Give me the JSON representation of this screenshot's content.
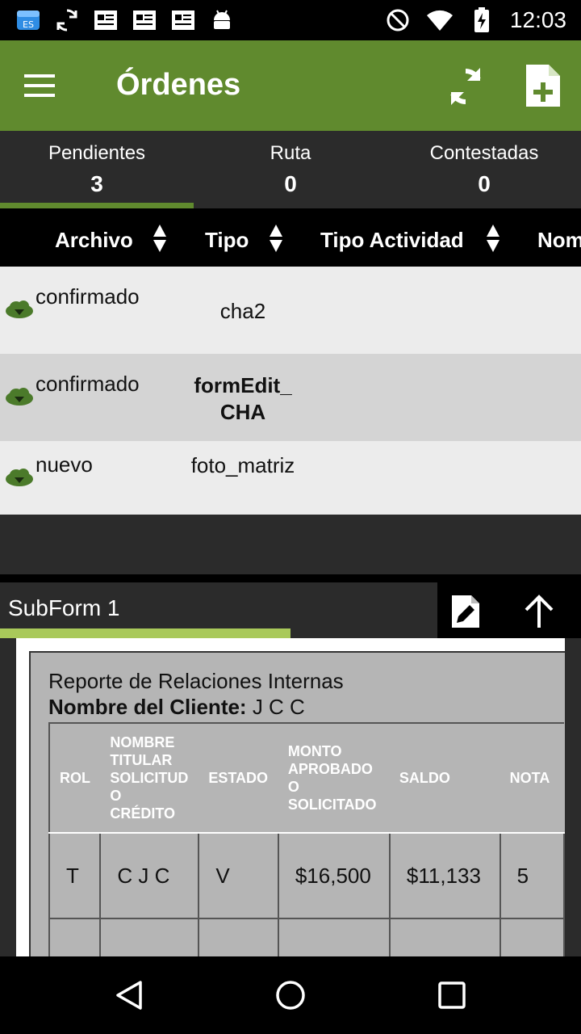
{
  "status_bar": {
    "time": "12:03",
    "left_icons": [
      "es-file-explorer-icon",
      "sync-icon",
      "news-icon",
      "news-icon-2",
      "news-icon-3",
      "android-debug-icon"
    ],
    "right_icons": [
      "do-not-disturb-icon",
      "wifi-icon",
      "battery-charging-icon"
    ]
  },
  "app_bar": {
    "title": "Órdenes",
    "color": "#608a2e"
  },
  "tabs": [
    {
      "label": "Pendientes",
      "count": "3",
      "selected": true
    },
    {
      "label": "Ruta",
      "count": "0",
      "selected": false
    },
    {
      "label": "Contestadas",
      "count": "0",
      "selected": false
    }
  ],
  "table": {
    "columns": [
      "Archivo",
      "Tipo",
      "Tipo Actividad",
      "Nom"
    ],
    "rows": [
      {
        "archivo": "confirmado",
        "tipo": "cha2",
        "bold": false
      },
      {
        "archivo": "confirmado",
        "tipo": "formEdit_CHA",
        "bold": true
      },
      {
        "archivo": "nuevo",
        "tipo": "foto_matriz",
        "bold": false
      }
    ]
  },
  "subform": {
    "title": "SubForm 1",
    "report_title": "Reporte de Relaciones Internas",
    "client_label": "Nombre del Cliente:",
    "client_value": " J C C",
    "report_table": {
      "headers": [
        "ROL",
        "NOMBRE TITULAR SOLICITUD O CRÉDITO",
        "ESTADO",
        "MONTO APROBADO O SOLICITADO",
        "SALDO",
        "NOTA"
      ],
      "rows": [
        [
          "T",
          "C J C",
          "V",
          "$16,500",
          "$11,133",
          "5"
        ]
      ]
    }
  }
}
